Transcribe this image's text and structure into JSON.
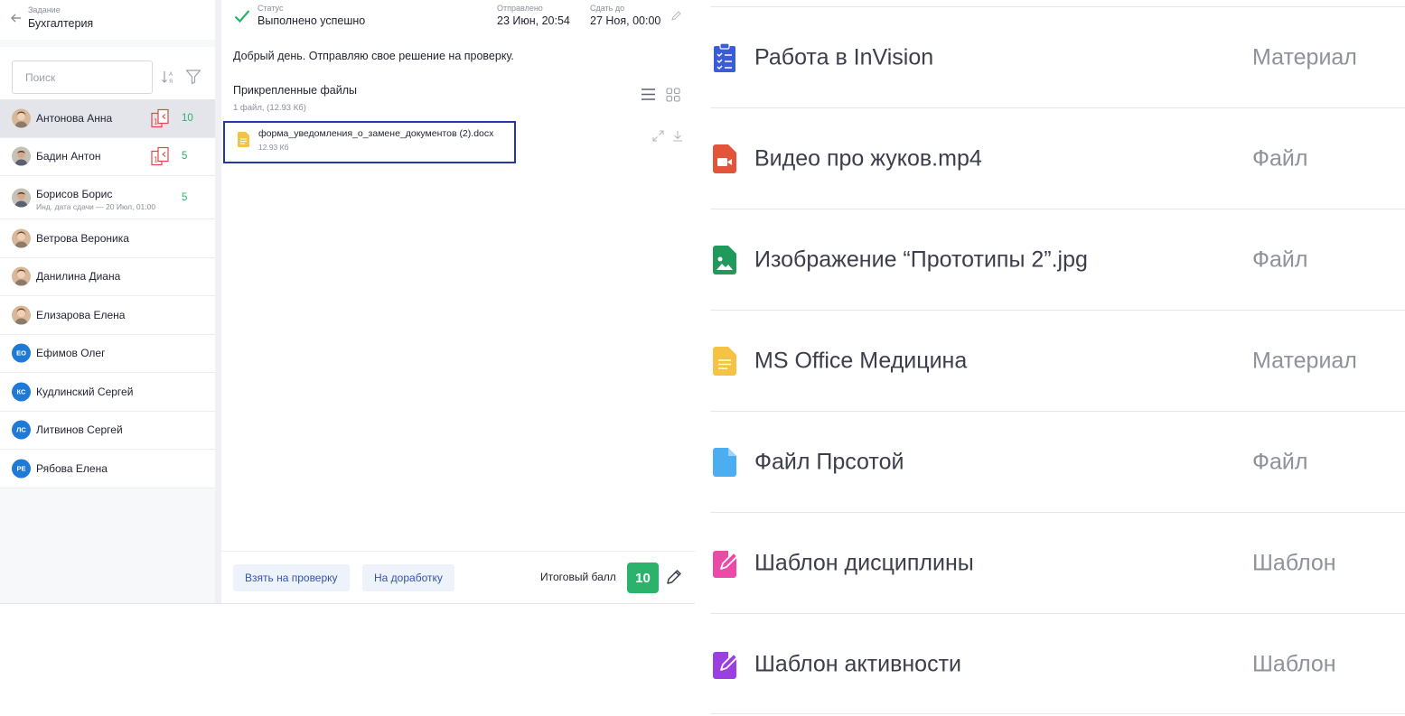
{
  "header": {
    "subtitle": "Задание",
    "title": "Бухгалтерия"
  },
  "search": {
    "placeholder": "Поиск"
  },
  "students": [
    {
      "name": "Антонова Анна",
      "score": "10",
      "avatar": "photo-female",
      "active": true,
      "has_copy_icon": true
    },
    {
      "name": "Бадин Антон",
      "score": "5",
      "avatar": "photo-male",
      "has_copy_icon": true
    },
    {
      "name": "Борисов Борис",
      "sub": "Инд. дата сдачи — 20 Июл, 01:00",
      "score": "5",
      "avatar": "photo-male"
    },
    {
      "name": "Ветрова Вероника",
      "avatar": "photo-female"
    },
    {
      "name": "Данилина Диана",
      "avatar": "photo-female"
    },
    {
      "name": "Елизарова Елена",
      "avatar": "photo-female"
    },
    {
      "name": "Ефимов Олег",
      "initials": "ЕО"
    },
    {
      "name": "Кудлинский Сергей",
      "initials": "КС"
    },
    {
      "name": "Литвинов Сергей",
      "initials": "ЛС"
    },
    {
      "name": "Рябова Елена",
      "initials": "РЕ"
    }
  ],
  "status": {
    "status_label": "Статус",
    "status_value": "Выполнено успешно",
    "sent_label": "Отправлено",
    "sent_value": "23 Июн, 20:54",
    "due_label": "Сдать до",
    "due_value": "27 Ноя, 00:00"
  },
  "message": "Добрый день. Отправляю свое решение на проверку.",
  "files": {
    "title": "Прикрепленные файлы",
    "count": "1 файл, (12.93 Кб)",
    "items": [
      {
        "name": "форма_уведомления_о_замене_документов (2).docx",
        "size": "12.93 Кб"
      }
    ]
  },
  "footer": {
    "review_button": "Взять на проверку",
    "rework_button": "На доработку",
    "total_label": "Итоговый балл",
    "total_value": "10"
  },
  "materials": [
    {
      "title": "Работа в InVision",
      "type": "Материал",
      "icon": "clipboard-icon",
      "color": "#3b5cd6"
    },
    {
      "title": "Видео про жуков.mp4",
      "type": "Файл",
      "icon": "video-file-icon",
      "color": "#e2553b"
    },
    {
      "title": "Изображение “Прототипы 2”.jpg",
      "type": "Файл",
      "icon": "image-file-icon",
      "color": "#1f9a5a"
    },
    {
      "title": "MS Office Медицина",
      "type": "Материал",
      "icon": "document-file-icon",
      "color": "#f5c243"
    },
    {
      "title": "Файл Прсотой",
      "type": "Файл",
      "icon": "blank-file-icon",
      "color": "#4aaef0"
    },
    {
      "title": "Шаблон дисциплины",
      "type": "Шаблон",
      "icon": "template-edit-icon",
      "color": "#ec4aa7"
    },
    {
      "title": "Шаблон активности",
      "type": "Шаблон",
      "icon": "template-edit-icon",
      "color": "#9b3fe0"
    }
  ],
  "colors": {
    "success": "#2bb36b",
    "accent_blue": "#2537a8",
    "button_text": "#3454b4",
    "warn_red": "#e04848"
  }
}
